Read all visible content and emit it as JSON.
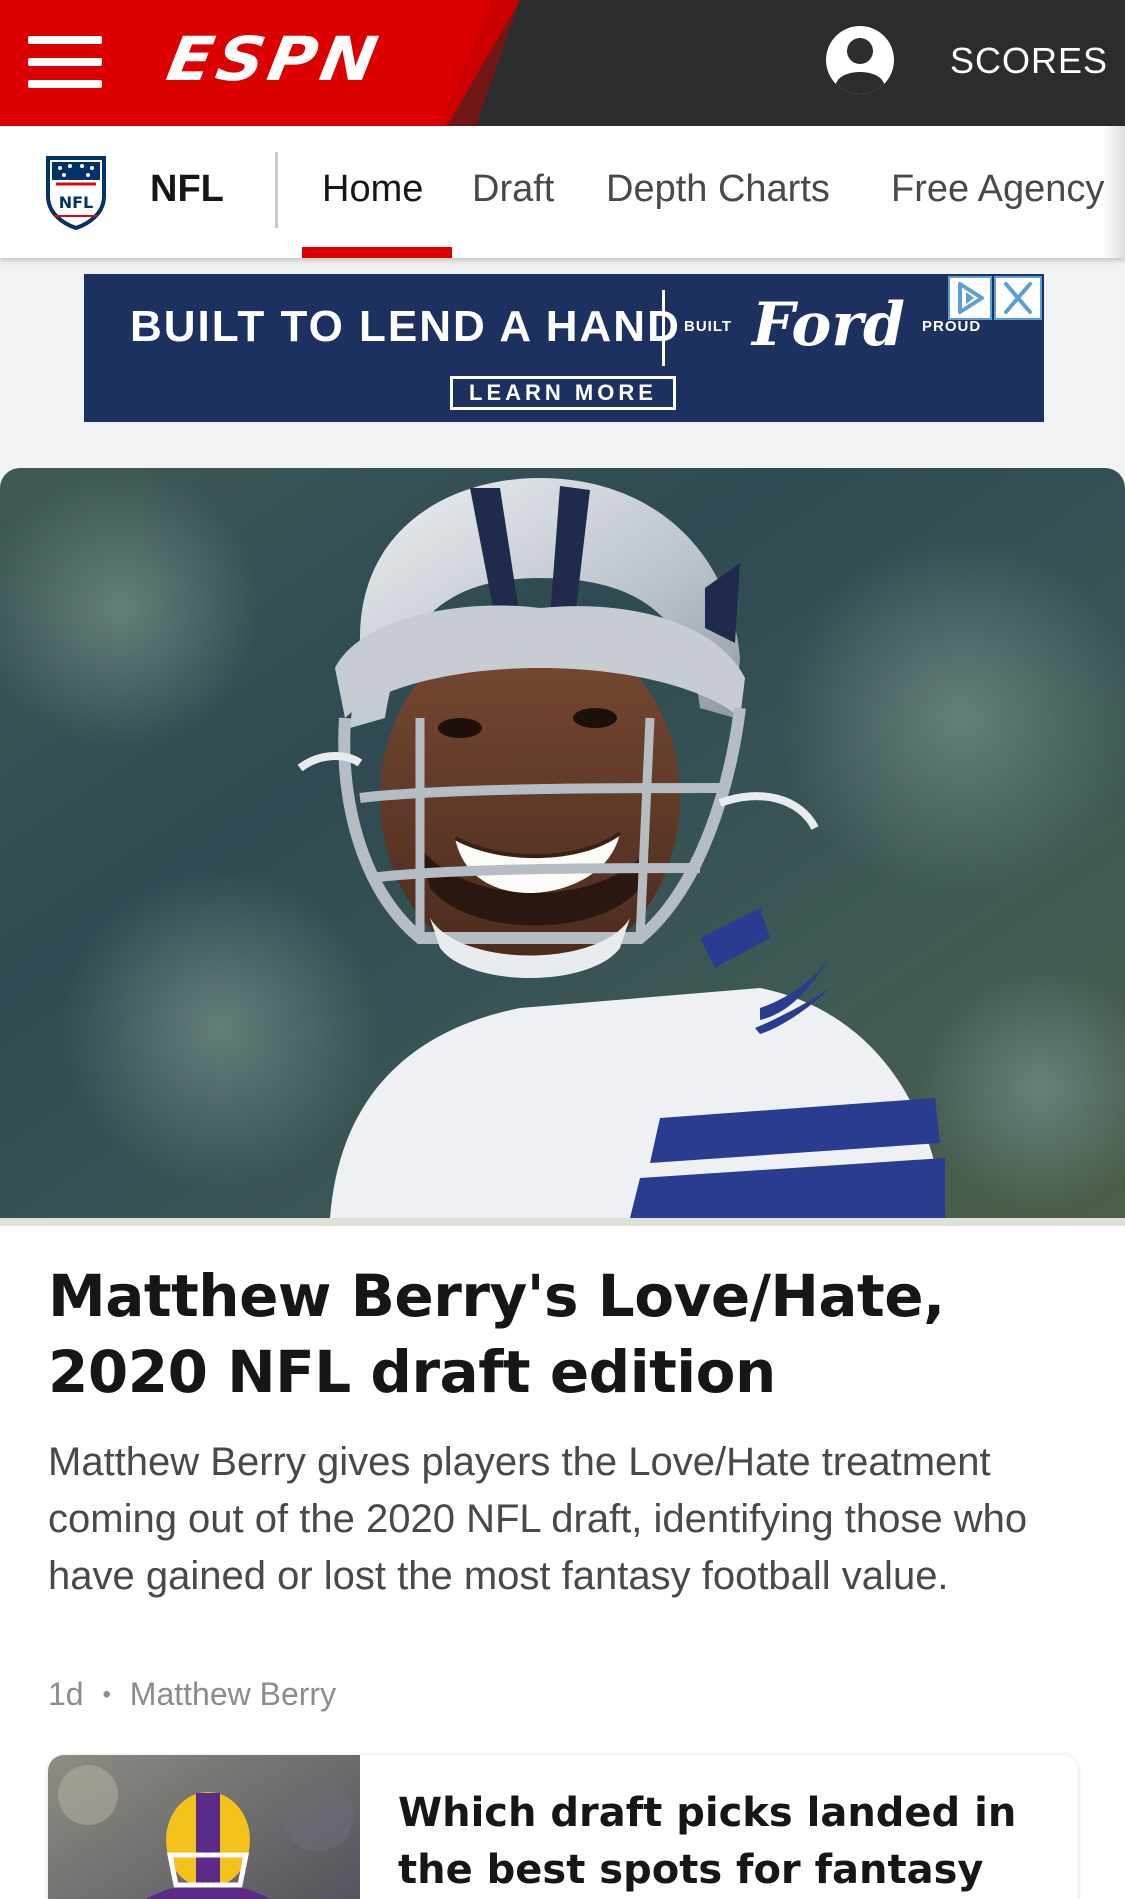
{
  "header": {
    "brand": "ESPN",
    "scores_label": "SCORES"
  },
  "subnav": {
    "league": "NFL",
    "tabs": [
      {
        "label": "Home",
        "active": true
      },
      {
        "label": "Draft",
        "active": false
      },
      {
        "label": "Depth Charts",
        "active": false
      },
      {
        "label": "Free Agency",
        "active": false
      }
    ]
  },
  "ad": {
    "tagline": "BUILT TO LEND A HAND",
    "built": "BUILT",
    "brand": "Ford",
    "proud": "PROUD",
    "cta": "LEARN MORE"
  },
  "hero": {
    "headline": "Matthew Berry's Love/Hate, 2020 NFL draft edition",
    "summary": "Matthew Berry gives players the Love/Hate treatment coming out of the 2020 NFL draft, identifying those who have gained or lost the most fantasy football value.",
    "age": "1d",
    "bullet": "•",
    "author": "Matthew Berry"
  },
  "story2": {
    "title": "Which draft picks landed in the best spots for fantasy"
  },
  "colors": {
    "espn_red": "#dd0000",
    "header_dark": "#2b2c2d",
    "ad_navy": "#1d3160"
  },
  "icons": [
    "hamburger-menu-icon",
    "account-icon",
    "nfl-shield-icon",
    "ad-choices-icon",
    "close-icon"
  ]
}
